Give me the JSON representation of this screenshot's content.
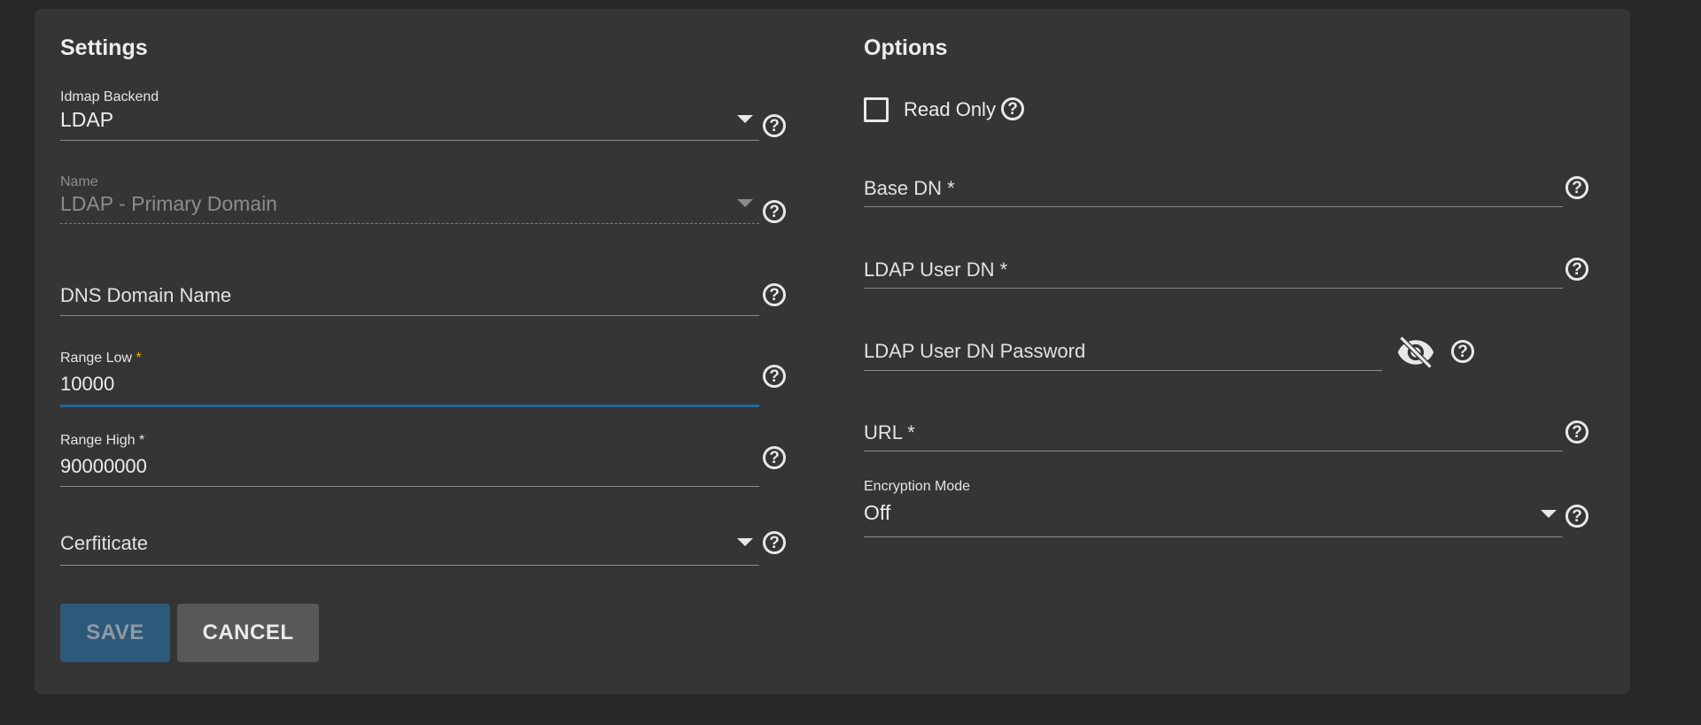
{
  "settings": {
    "title": "Settings",
    "idmap_backend": {
      "label": "Idmap Backend",
      "value": "LDAP"
    },
    "name": {
      "label": "Name",
      "value": "LDAP - Primary Domain"
    },
    "dns_domain_name": {
      "placeholder": "DNS Domain Name"
    },
    "range_low": {
      "label": "Range Low",
      "required_mark": "*",
      "value": "10000"
    },
    "range_high": {
      "label": "Range High *",
      "value": "90000000"
    },
    "certificate": {
      "placeholder": "Cerfiticate"
    }
  },
  "options": {
    "title": "Options",
    "read_only": {
      "label": "Read Only",
      "checked": false
    },
    "base_dn": {
      "placeholder": "Base DN *"
    },
    "ldap_user_dn": {
      "placeholder": "LDAP User DN *"
    },
    "ldap_user_dn_password": {
      "placeholder": "LDAP User DN Password"
    },
    "url": {
      "placeholder": "URL *"
    },
    "encryption_mode": {
      "label": "Encryption Mode",
      "value": "Off"
    }
  },
  "actions": {
    "save_label": "SAVE",
    "cancel_label": "CANCEL"
  },
  "icons": {
    "help": "help-circle-icon",
    "visibility": "eye-off-icon",
    "dropdown": "arrow-drop-down-icon"
  },
  "colors": {
    "focus_underline": "#1f6a96",
    "required": "#f0b400",
    "save_bg": "#2d5a7a",
    "cancel_bg": "#585858"
  }
}
